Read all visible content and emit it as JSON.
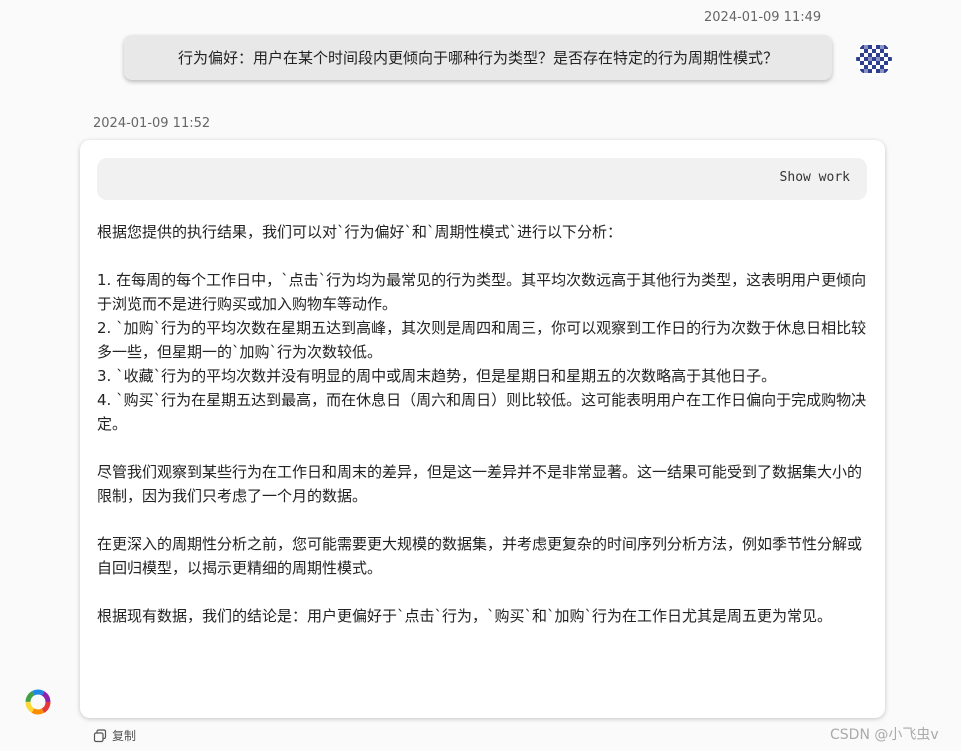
{
  "user_message": {
    "timestamp": "2024-01-09 11:49",
    "text": "行为偏好：用户在某个时间段内更倾向于哪种行为类型？是否存在特定的行为周期性模式？"
  },
  "bot_message": {
    "timestamp": "2024-01-09 11:52",
    "show_work_label": "Show work",
    "intro": "根据您提供的执行结果，我们可以对`行为偏好`和`周期性模式`进行以下分析：",
    "points": [
      "1. 在每周的每个工作日中，`点击`行为均为最常见的行为类型。其平均次数远高于其他行为类型，这表明用户更倾向于浏览而不是进行购买或加入购物车等动作。",
      "2. `加购`行为的平均次数在星期五达到高峰，其次则是周四和周三，你可以观察到工作日的行为次数于休息日相比较多一些，但星期一的`加购`行为次数较低。",
      "3. `收藏`行为的平均次数并没有明显的周中或周末趋势，但是星期日和星期五的次数略高于其他日子。",
      "4. `购买`行为在星期五达到最高，而在休息日（周六和周日）则比较低。这可能表明用户在工作日偏向于完成购物决定。"
    ],
    "para2": "尽管我们观察到某些行为在工作日和周末的差异，但是这一差异并不是非常显著。这一结果可能受到了数据集大小的限制，因为我们只考虑了一个月的数据。",
    "para3": "在更深入的周期性分析之前，您可能需要更大规模的数据集，并考虑更复杂的时间序列分析方法，例如季节性分解或自回归模型，以揭示更精细的周期性模式。",
    "conclusion": "根据现有数据，我们的结论是：用户更偏好于`点击`行为，`购买`和`加购`行为在工作日尤其是周五更为常见。",
    "copy_label": "复制"
  },
  "watermark": "CSDN @小飞虫v",
  "colors": {
    "page_bg": "#fafafa",
    "user_bubble_bg": "#e8e8e8",
    "show_work_bg": "#f1f1f1",
    "avatar_blue": "#2e3f8f"
  },
  "icons": {
    "user_avatar": "pixel-avatar-icon",
    "bot_logo": "colorful-ring-logo-icon",
    "copy": "copy-icon"
  }
}
